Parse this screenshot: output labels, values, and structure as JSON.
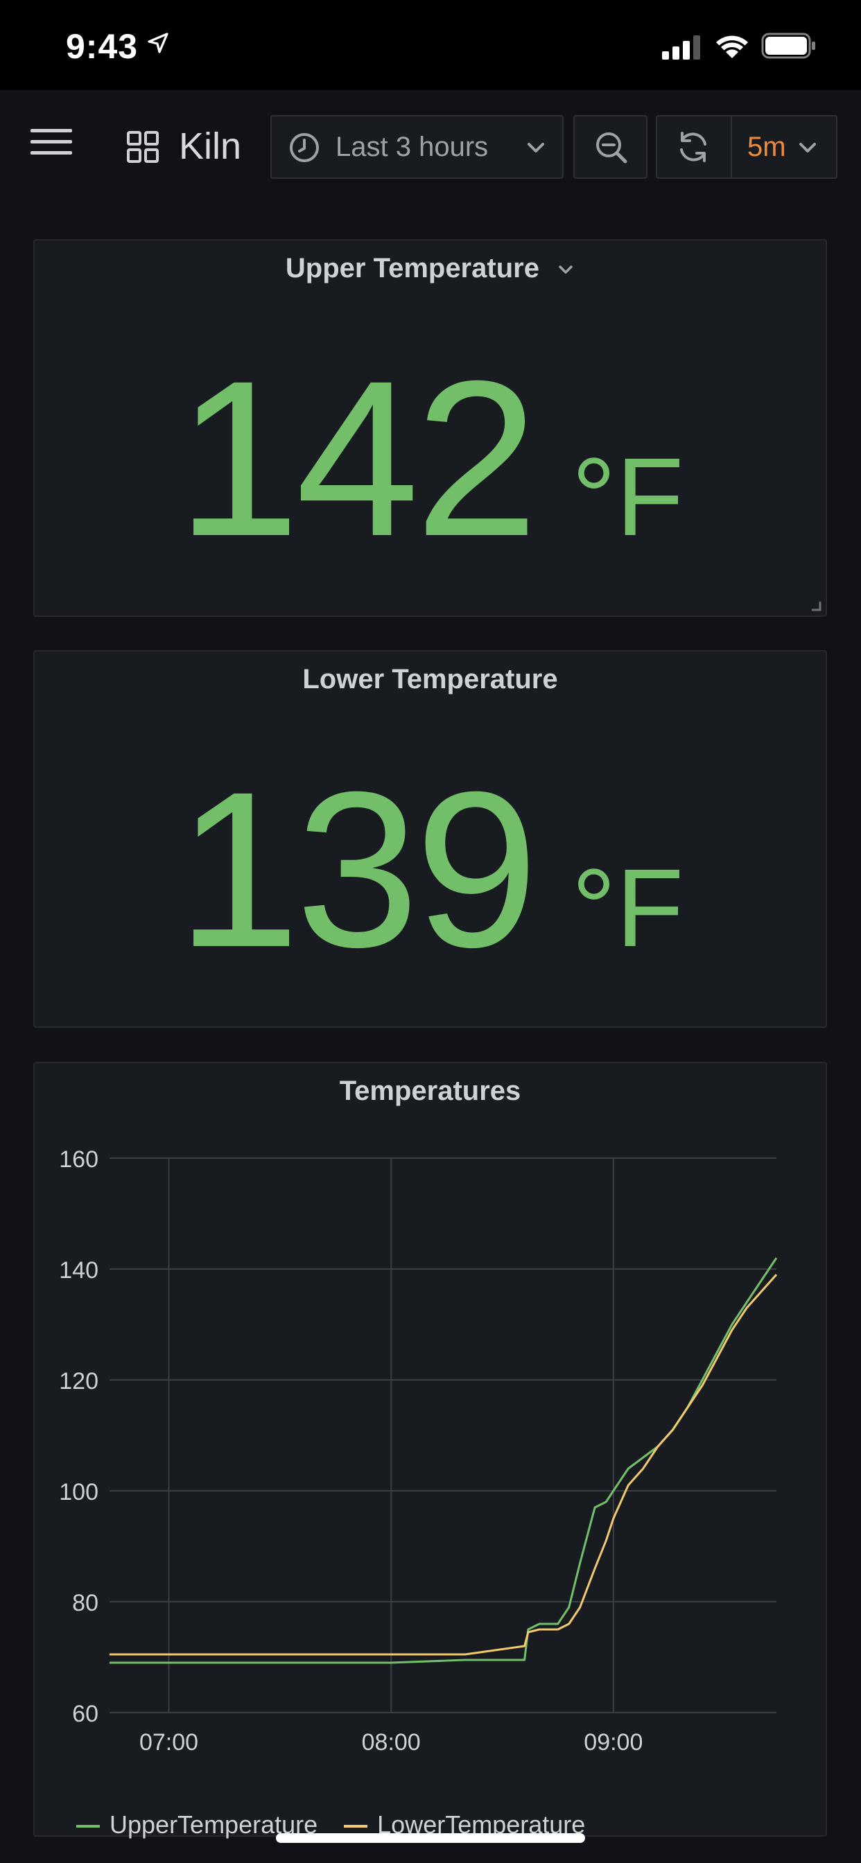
{
  "status_bar": {
    "time": "9:43"
  },
  "toolbar": {
    "dashboard_title": "Kiln",
    "time_range": "Last 3 hours",
    "refresh_interval": "5m",
    "accent_color": "#ee8a3a"
  },
  "panels": {
    "upper": {
      "title": "Upper Temperature",
      "value": "142",
      "unit": "°F"
    },
    "lower": {
      "title": "Lower Temperature",
      "value": "139",
      "unit": "°F"
    },
    "chart": {
      "title": "Temperatures"
    }
  },
  "chart_data": {
    "type": "line",
    "title": "Temperatures",
    "xlabel": "",
    "ylabel": "",
    "x_ticks": [
      "07:00",
      "08:00",
      "09:00"
    ],
    "y_ticks": [
      60,
      80,
      100,
      120,
      140,
      160
    ],
    "ylim": [
      60,
      160
    ],
    "xlim": [
      "06:44",
      "09:44"
    ],
    "grid": true,
    "legend": "bottom",
    "series": [
      {
        "name": "UpperTemperature",
        "color": "#73bf69",
        "x": [
          "06:44",
          "07:00",
          "07:20",
          "07:40",
          "08:00",
          "08:20",
          "08:36",
          "08:37",
          "08:40",
          "08:45",
          "08:48",
          "08:51",
          "08:55",
          "08:58",
          "09:00",
          "09:04",
          "09:08",
          "09:12",
          "09:16",
          "09:20",
          "09:24",
          "09:28",
          "09:32",
          "09:36",
          "09:40",
          "09:44"
        ],
        "values": [
          69,
          69,
          69,
          69,
          69,
          69.5,
          69.5,
          75,
          76,
          76,
          79,
          87,
          97,
          98,
          100,
          104,
          106,
          108,
          111,
          115,
          120,
          125,
          130,
          134,
          138,
          142
        ]
      },
      {
        "name": "LowerTemperature",
        "color": "#f2c96d",
        "x": [
          "06:44",
          "07:00",
          "07:20",
          "07:40",
          "08:00",
          "08:20",
          "08:36",
          "08:37",
          "08:40",
          "08:45",
          "08:48",
          "08:51",
          "08:55",
          "08:58",
          "09:00",
          "09:04",
          "09:08",
          "09:12",
          "09:16",
          "09:20",
          "09:24",
          "09:28",
          "09:32",
          "09:36",
          "09:40",
          "09:44"
        ],
        "values": [
          70.5,
          70.5,
          70.5,
          70.5,
          70.5,
          70.5,
          72,
          74.5,
          75,
          75,
          76,
          79,
          86,
          91,
          95,
          101,
          104,
          108,
          111,
          115,
          119,
          124,
          129,
          133,
          136,
          139
        ]
      }
    ]
  }
}
